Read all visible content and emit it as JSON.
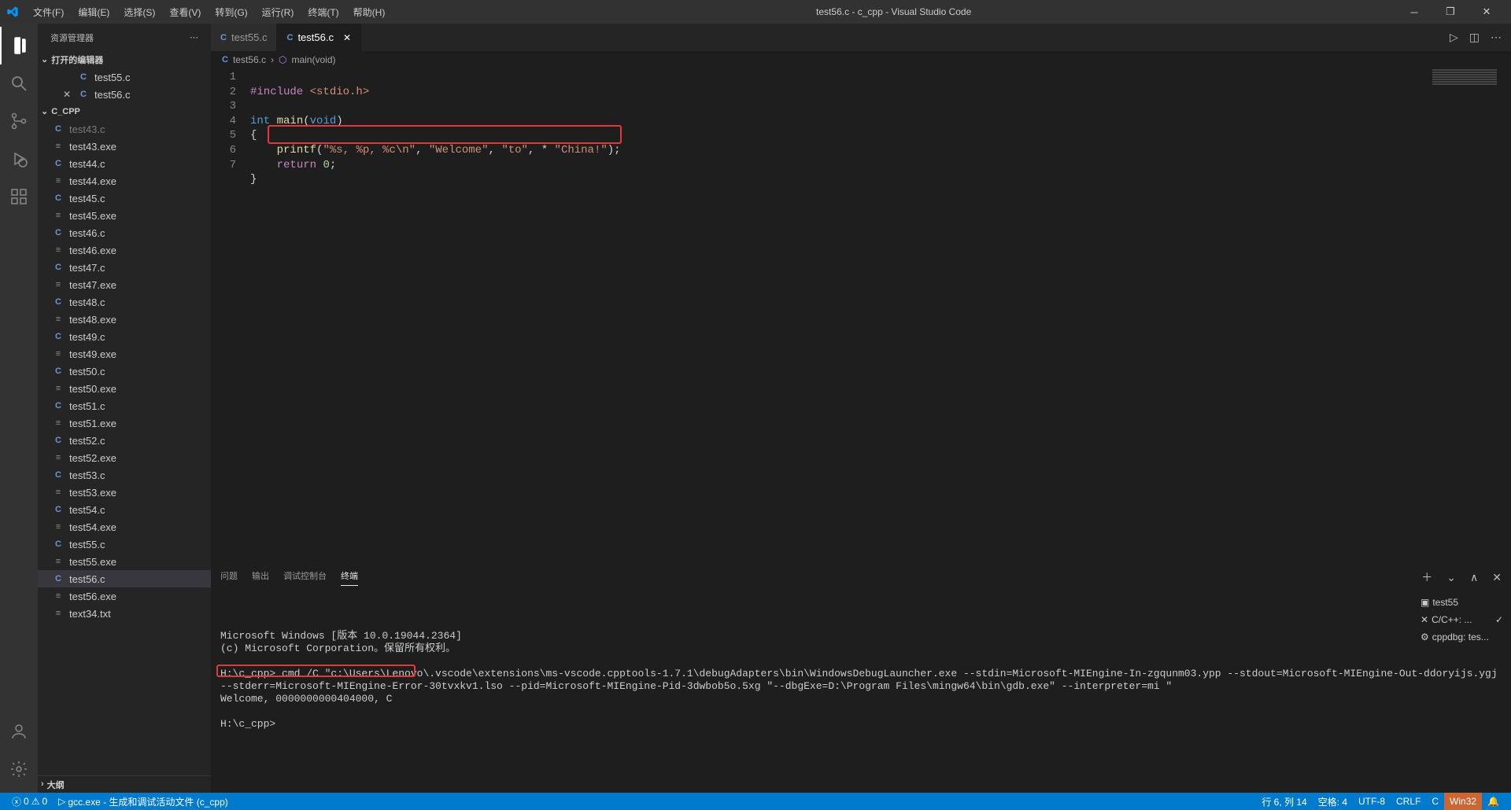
{
  "window": {
    "title": "test56.c - c_cpp - Visual Studio Code"
  },
  "menus": [
    "文件(F)",
    "编辑(E)",
    "选择(S)",
    "查看(V)",
    "转到(G)",
    "运行(R)",
    "终端(T)",
    "帮助(H)"
  ],
  "explorer": {
    "title": "资源管理器",
    "open_editors_label": "打开的编辑器",
    "open_editors": [
      {
        "name": "test55.c",
        "icon": "C",
        "close": false
      },
      {
        "name": "test56.c",
        "icon": "C",
        "close": true
      }
    ],
    "folder": "C_CPP",
    "files": [
      {
        "name": "test43.c",
        "kind": "c",
        "dim": true
      },
      {
        "name": "test43.exe",
        "kind": "exe"
      },
      {
        "name": "test44.c",
        "kind": "c"
      },
      {
        "name": "test44.exe",
        "kind": "exe"
      },
      {
        "name": "test45.c",
        "kind": "c"
      },
      {
        "name": "test45.exe",
        "kind": "exe"
      },
      {
        "name": "test46.c",
        "kind": "c"
      },
      {
        "name": "test46.exe",
        "kind": "exe"
      },
      {
        "name": "test47.c",
        "kind": "c"
      },
      {
        "name": "test47.exe",
        "kind": "exe"
      },
      {
        "name": "test48.c",
        "kind": "c"
      },
      {
        "name": "test48.exe",
        "kind": "exe"
      },
      {
        "name": "test49.c",
        "kind": "c"
      },
      {
        "name": "test49.exe",
        "kind": "exe"
      },
      {
        "name": "test50.c",
        "kind": "c"
      },
      {
        "name": "test50.exe",
        "kind": "exe"
      },
      {
        "name": "test51.c",
        "kind": "c"
      },
      {
        "name": "test51.exe",
        "kind": "exe"
      },
      {
        "name": "test52.c",
        "kind": "c"
      },
      {
        "name": "test52.exe",
        "kind": "exe"
      },
      {
        "name": "test53.c",
        "kind": "c"
      },
      {
        "name": "test53.exe",
        "kind": "exe"
      },
      {
        "name": "test54.c",
        "kind": "c"
      },
      {
        "name": "test54.exe",
        "kind": "exe"
      },
      {
        "name": "test55.c",
        "kind": "c"
      },
      {
        "name": "test55.exe",
        "kind": "exe"
      },
      {
        "name": "test56.c",
        "kind": "c",
        "selected": true
      },
      {
        "name": "test56.exe",
        "kind": "exe"
      },
      {
        "name": "text34.txt",
        "kind": "txt"
      }
    ],
    "outline_label": "大纲"
  },
  "tabs": [
    {
      "name": "test55.c",
      "icon": "C",
      "active": false
    },
    {
      "name": "test56.c",
      "icon": "C",
      "active": true,
      "close": true
    }
  ],
  "breadcrumb": {
    "file": "test56.c",
    "symbol": "main(void)"
  },
  "code": {
    "lines": [
      "1",
      "2",
      "3",
      "4",
      "5",
      "6",
      "7"
    ],
    "tokens": {
      "include": "#include",
      "stdio": "<stdio.h>",
      "int": "int",
      "main": "main",
      "void": "void",
      "printf": "printf",
      "fmt": "\"%s, %p, %c\\n\"",
      "s1": "\"Welcome\"",
      "s2": "\"to\"",
      "s3": "\"China!\"",
      "return": "return",
      "zero": "0",
      "star": " * "
    }
  },
  "panel": {
    "tabs": [
      "问题",
      "输出",
      "调试控制台",
      "终端"
    ],
    "active_tab": 3,
    "right": [
      {
        "icon": "▣",
        "label": "test55"
      },
      {
        "icon": "✕",
        "label": "C/C++: ...",
        "check": "✓"
      },
      {
        "icon": "⚙",
        "label": "cppdbg: tes..."
      }
    ],
    "terminal_lines": [
      "Microsoft Windows [版本 10.0.19044.2364]",
      "(c) Microsoft Corporation。保留所有权利。",
      "",
      "H:\\c_cpp> cmd /C \"c:\\Users\\Lenovo\\.vscode\\extensions\\ms-vscode.cpptools-1.7.1\\debugAdapters\\bin\\WindowsDebugLauncher.exe --stdin=Microsoft-MIEngine-In-zgqunm03.ypp --stdout=Microsoft-MIEngine-Out-ddoryijs.ygj --stderr=Microsoft-MIEngine-Error-30tvxkv1.lso --pid=Microsoft-MIEngine-Pid-3dwbob5o.5xg \"--dbgExe=D:\\Program Files\\mingw64\\bin\\gdb.exe\" --interpreter=mi \"",
      "Welcome, 0000000000404000, C",
      "",
      "H:\\c_cpp>"
    ]
  },
  "status": {
    "left": {
      "errors": "0",
      "warnings": "0",
      "config": "gcc.exe - 生成和调试活动文件 (c_cpp)"
    },
    "right": {
      "lncol": "行 6, 列 14",
      "spaces": "空格: 4",
      "encoding": "UTF-8",
      "eol": "CRLF",
      "lang": "C",
      "win": "Win32"
    }
  }
}
